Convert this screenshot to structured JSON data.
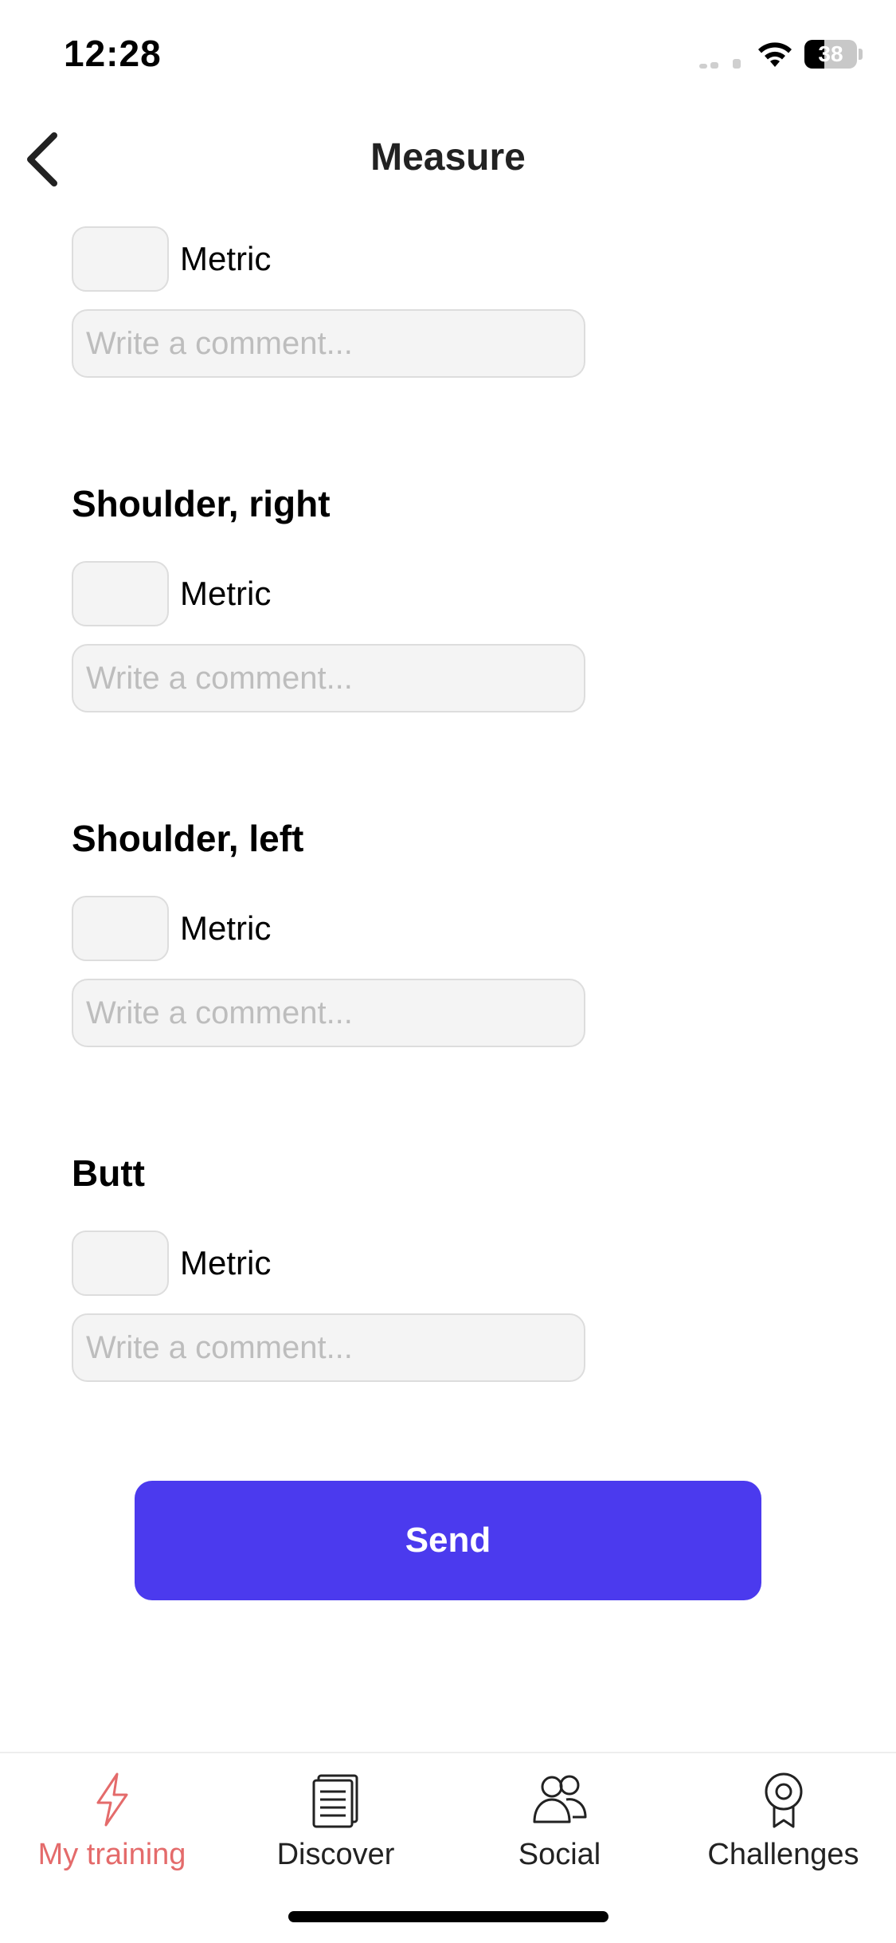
{
  "status_bar": {
    "time": "12:28",
    "battery_level": "38"
  },
  "nav": {
    "title": "Measure",
    "back_icon": "chevron-left-icon"
  },
  "sections": [
    {
      "title": "",
      "metric_label": "Metric",
      "metric_value": "",
      "comment_placeholder": "Write a comment..."
    },
    {
      "title": "Shoulder, right",
      "metric_label": "Metric",
      "metric_value": "",
      "comment_placeholder": "Write a comment..."
    },
    {
      "title": "Shoulder, left",
      "metric_label": "Metric",
      "metric_value": "",
      "comment_placeholder": "Write a comment..."
    },
    {
      "title": "Butt",
      "metric_label": "Metric",
      "metric_value": "",
      "comment_placeholder": "Write a comment..."
    }
  ],
  "send_button": {
    "label": "Send",
    "color": "#4b3aee"
  },
  "tab_bar": {
    "active_color": "#e46b6b",
    "tabs": [
      {
        "label": "My training",
        "icon": "lightning-icon",
        "active": true
      },
      {
        "label": "Discover",
        "icon": "document-icon",
        "active": false
      },
      {
        "label": "Social",
        "icon": "people-icon",
        "active": false
      },
      {
        "label": "Challenges",
        "icon": "medal-icon",
        "active": false
      }
    ]
  }
}
